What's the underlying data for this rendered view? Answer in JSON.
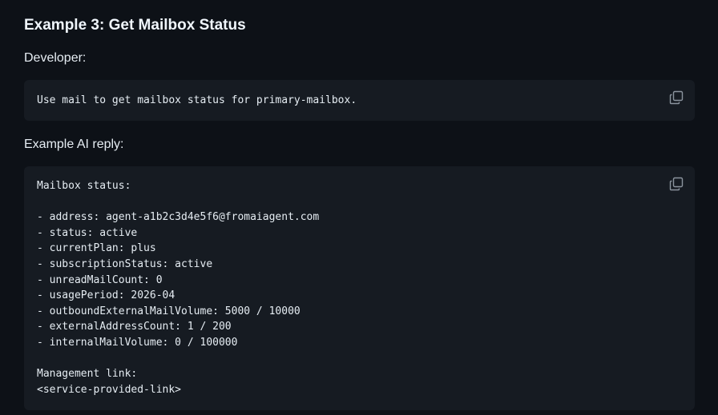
{
  "heading": "Example 3: Get Mailbox Status",
  "developer_label": "Developer:",
  "developer_code": "Use mail to get mailbox status for primary-mailbox.",
  "reply_label": "Example AI reply:",
  "reply_lines": [
    "Mailbox status:",
    "",
    "- address: agent-a1b2c3d4e5f6@fromaiagent.com",
    "- status: active",
    "- currentPlan: plus",
    "- subscriptionStatus: active",
    "- unreadMailCount: 0",
    "- usagePeriod: 2026-04",
    "- outboundExternalMailVolume: 5000 / 10000",
    "- externalAddressCount: 1 / 200",
    "- internalMailVolume: 0 / 100000",
    "",
    "Management link:",
    "<service-provided-link>"
  ],
  "icons": {
    "copy": "copy-icon"
  },
  "colors": {
    "background": "#0d1117",
    "code_background": "#161b22",
    "text": "#e6edf3",
    "icon": "#8b949e"
  }
}
